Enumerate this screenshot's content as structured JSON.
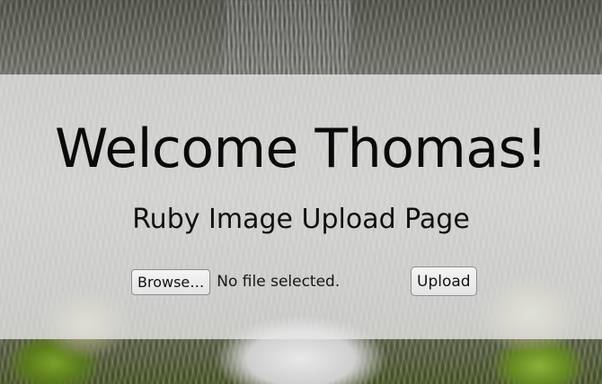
{
  "page": {
    "heading": "Welcome Thomas!",
    "subheading": "Ruby Image Upload Page"
  },
  "form": {
    "browse_label": "Browse…",
    "file_status": "No file selected.",
    "upload_label": "Upload"
  },
  "colors": {
    "banner_overlay": "#e8e8e8",
    "text": "#0a0a0a",
    "button_border": "#8c8c8c"
  }
}
